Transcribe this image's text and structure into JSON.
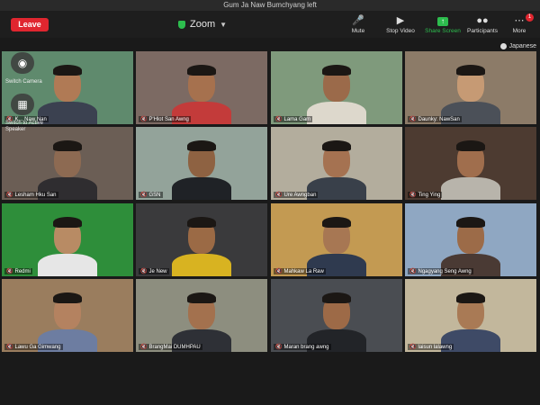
{
  "window": {
    "title": "Gum Ja Naw Bumchyang left"
  },
  "toolbar": {
    "leave_label": "Leave",
    "meeting_title": "Zoom",
    "buttons": [
      {
        "label": "Mute",
        "icon": "microphone-icon"
      },
      {
        "label": "Stop Video",
        "icon": "video-camera-icon"
      },
      {
        "label": "Share Screen",
        "icon": "share-screen-icon"
      },
      {
        "label": "Participants",
        "icon": "participants-icon"
      },
      {
        "label": "More",
        "icon": "more-icon"
      }
    ],
    "more_badge": "1"
  },
  "language": {
    "label": "Japanese"
  },
  "overlay": {
    "switch_camera": "Switch Camera",
    "switch_speaker": "Switch to Active Speaker"
  },
  "participants": [
    {
      "name": "K... Naw Nan",
      "muted": true,
      "bg": "#5f8a6d",
      "skin": "#b07a55",
      "shirt": "#3b4150",
      "active": true
    },
    {
      "name": "P'Hlot San Awng",
      "muted": true,
      "bg": "#7c6a63",
      "skin": "#a6714e",
      "shirt": "#c33b3a"
    },
    {
      "name": "Lama Gam",
      "muted": true,
      "bg": "#7f9a7c",
      "skin": "#9b6a4a",
      "shirt": "#ddd8cc"
    },
    {
      "name": "Daunky: NawSan",
      "muted": true,
      "bg": "#8c7b68",
      "skin": "#c69a74",
      "shirt": "#4b5058"
    },
    {
      "name": "Lesham Hku San",
      "muted": true,
      "bg": "#6b5e55",
      "skin": "#8d6a52",
      "shirt": "#2f2d30"
    },
    {
      "name": "GSN",
      "muted": true,
      "bg": "#93a39a",
      "skin": "#8e6242",
      "shirt": "#1f2226"
    },
    {
      "name": "Ure Awngban",
      "muted": true,
      "bg": "#b3ad9d",
      "skin": "#a57251",
      "shirt": "#39404a"
    },
    {
      "name": "Ting Ying",
      "muted": true,
      "bg": "#4d3b31",
      "skin": "#a06e4d",
      "shirt": "#b8b4ab"
    },
    {
      "name": "Redmi",
      "muted": true,
      "bg": "#2e8e3a",
      "skin": "#b88b64",
      "shirt": "#e6e6e6"
    },
    {
      "name": "Je New",
      "muted": true,
      "bg": "#3a3a3c",
      "skin": "#9b6a45",
      "shirt": "#d8b321"
    },
    {
      "name": "Mahkaw La Raw",
      "muted": true,
      "bg": "#c39a52",
      "skin": "#a77753",
      "shirt": "#2f3a4f"
    },
    {
      "name": "Ngagyang Seng Awng",
      "muted": true,
      "bg": "#8fa7c2",
      "skin": "#9c6b48",
      "shirt": "#4a3a34"
    },
    {
      "name": "Lawu Ga Gimwang",
      "muted": true,
      "bg": "#9a7d5e",
      "skin": "#b48260",
      "shirt": "#6d7da1"
    },
    {
      "name": "BrangMai DUMHPAU",
      "muted": true,
      "bg": "#8d8e7f",
      "skin": "#a3714e",
      "shirt": "#2e3036"
    },
    {
      "name": "Maran brang awng",
      "muted": true,
      "bg": "#4a4d52",
      "skin": "#9d6a47",
      "shirt": "#222428"
    },
    {
      "name": "laisun lalawng",
      "muted": true,
      "bg": "#c2b79c",
      "skin": "#a97a55",
      "shirt": "#3e4a66"
    }
  ]
}
